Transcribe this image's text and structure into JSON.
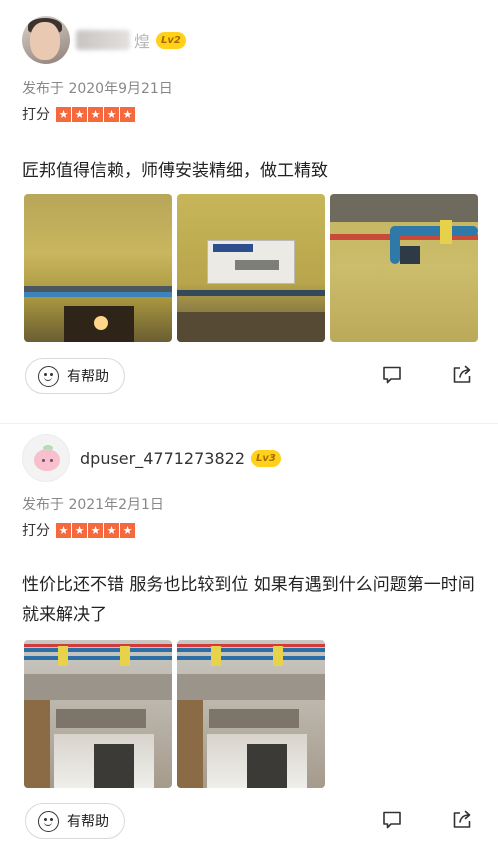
{
  "reviews": [
    {
      "username": "煌",
      "level": "Lv2",
      "meta": "发布于 2020年9月21日",
      "rating_label": "打分",
      "stars": 5,
      "content": "匠邦值得信赖，师傅安装精细，做工精致",
      "photo_count": 3,
      "helpful_label": "有帮助"
    },
    {
      "username": "dpuser_4771273822",
      "level": "Lv3",
      "meta": "发布于 2021年2月1日",
      "rating_label": "打分",
      "stars": 5,
      "content": "性价比还不错   服务也比较到位 如果有遇到什么问题第一时间就来解决了",
      "photo_count": 2,
      "helpful_label": "有帮助"
    }
  ],
  "colors": {
    "star": "#f46a3e",
    "level_badge": "#ffd11a"
  },
  "icons": [
    "smile-icon",
    "comment-icon",
    "share-icon",
    "star-icon"
  ]
}
